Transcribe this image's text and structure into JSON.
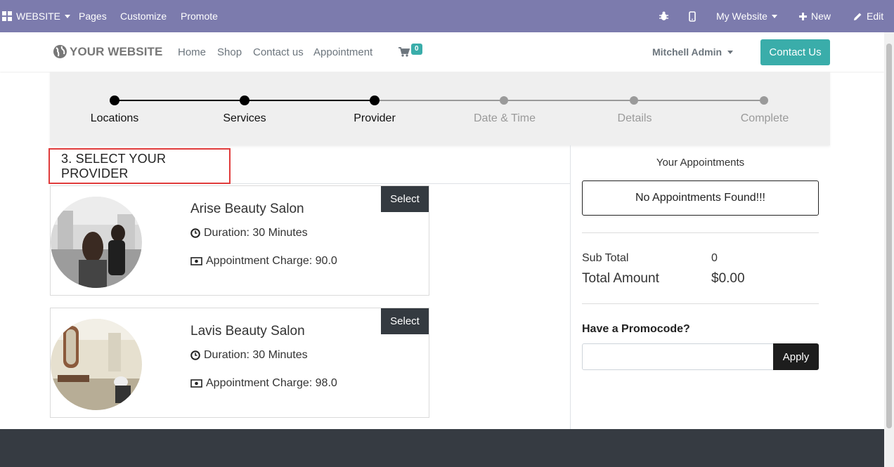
{
  "adminbar": {
    "apps_label": "WEBSITE",
    "menu": [
      "Pages",
      "Customize",
      "Promote"
    ],
    "website_selector": "My Website",
    "new_label": "New",
    "edit_label": "Edit"
  },
  "header": {
    "logo_text": "YOUR WEBSITE",
    "nav": [
      "Home",
      "Shop",
      "Contact us",
      "Appointment"
    ],
    "cart_count": "0",
    "user_name": "Mitchell Admin",
    "contact_button": "Contact Us"
  },
  "progress": {
    "steps": [
      {
        "label": "Locations",
        "state": "done"
      },
      {
        "label": "Services",
        "state": "done"
      },
      {
        "label": "Provider",
        "state": "active"
      },
      {
        "label": "Date & Time",
        "state": "todo"
      },
      {
        "label": "Details",
        "state": "todo"
      },
      {
        "label": "Complete",
        "state": "todo"
      }
    ],
    "colors": {
      "done": "#000000",
      "todo": "#9a9a9a"
    }
  },
  "section": {
    "heading": "3. SELECT YOUR PROVIDER"
  },
  "providers": [
    {
      "name": "Arise Beauty Salon",
      "duration": "Duration: 30 Minutes",
      "charge": "Appointment Charge: 90.0",
      "select_label": "Select"
    },
    {
      "name": "Lavis Beauty Salon",
      "duration": "Duration: 30 Minutes",
      "charge": "Appointment Charge: 98.0",
      "select_label": "Select"
    }
  ],
  "summary": {
    "title": "Your Appointments",
    "empty_message": "No Appointments Found!!!",
    "subtotal_label": "Sub Total",
    "subtotal_value": "0",
    "total_label": "Total Amount",
    "total_value": "$0.00",
    "promo_title": "Have a Promocode?",
    "promo_placeholder": "",
    "apply_label": "Apply"
  },
  "icons": {
    "apps": "grid-icon",
    "debug": "bug-icon",
    "mobile": "mobile-icon",
    "new": "plus-icon",
    "edit": "pencil-icon",
    "logo": "globe-icon",
    "cart": "cart-icon",
    "clock": "clock-icon",
    "money": "money-icon"
  },
  "colors": {
    "adminbar": "#7c7bad",
    "accent": "#3aadaa",
    "highlight_border": "#e03b3b",
    "footer": "#363b42"
  }
}
